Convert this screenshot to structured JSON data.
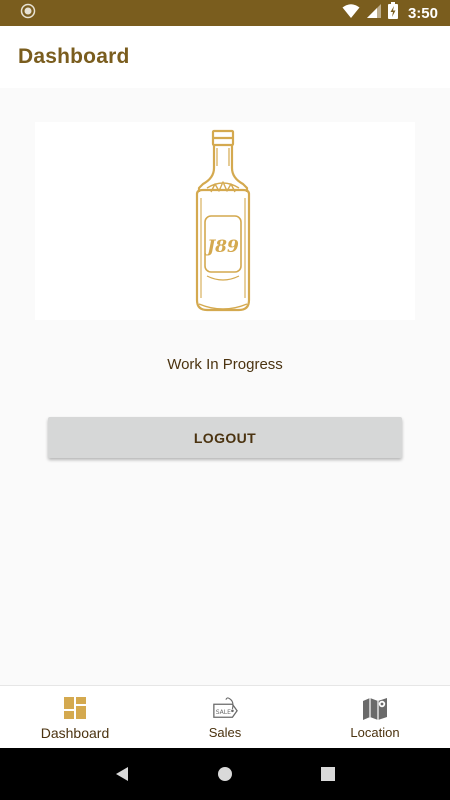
{
  "status_bar": {
    "time": "3:50",
    "icons": [
      "wifi-icon",
      "signal-icon",
      "battery-charging-icon"
    ],
    "notification_icon": "sync-icon"
  },
  "app_bar": {
    "title": "Dashboard"
  },
  "logo": {
    "icon": "bottle-logo",
    "text": "J89"
  },
  "main": {
    "status_text": "Work In Progress",
    "logout_label": "LOGOUT"
  },
  "bottom_nav": {
    "items": [
      {
        "label": "Dashboard",
        "icon": "dashboard-icon",
        "active": true
      },
      {
        "label": "Sales",
        "icon": "sale-tag-icon",
        "active": false
      },
      {
        "label": "Location",
        "icon": "map-icon",
        "active": false
      }
    ]
  },
  "system_nav": {
    "buttons": [
      "back-icon",
      "home-icon",
      "recents-icon"
    ]
  },
  "colors": {
    "brand": "#7a5d1e",
    "accent_gold": "#d4a94f",
    "text_dark": "#4b3310",
    "button_bg": "#d6d7d7"
  }
}
